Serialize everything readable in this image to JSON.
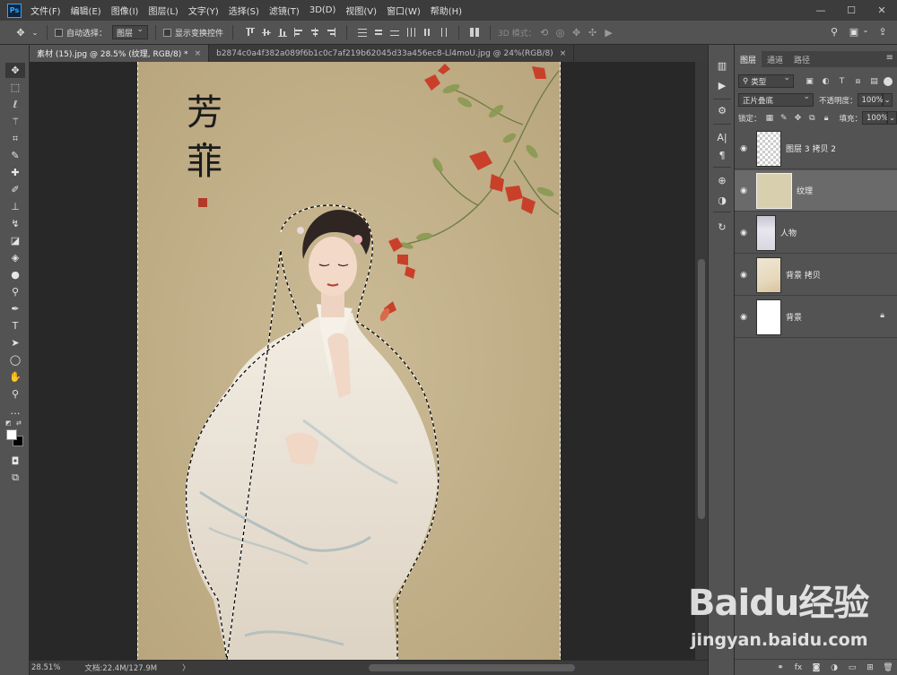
{
  "app": {
    "logo": "Ps"
  },
  "menu": [
    "文件(F)",
    "编辑(E)",
    "图像(I)",
    "图层(L)",
    "文字(Y)",
    "选择(S)",
    "滤镜(T)",
    "3D(D)",
    "视图(V)",
    "窗口(W)",
    "帮助(H)"
  ],
  "window_controls": {
    "minimize": "—",
    "maximize": "☐",
    "close": "✕"
  },
  "options": {
    "auto_select_label": "自动选择：",
    "auto_select_target": "图层",
    "show_transform_label": "显示变换控件",
    "mode_3d_label": "3D 模式："
  },
  "tabs": [
    {
      "title": "素材 (15).jpg @ 28.5% (纹理, RGB/8) *",
      "close": "×"
    },
    {
      "title": "b2874c0a4f382a089f6b1c0c7af219b62045d33a456ec8-Ll4moU.jpg @ 24%(RGB/8)",
      "close": "×"
    }
  ],
  "canvas": {
    "title_chars": [
      "芳",
      "菲"
    ],
    "background_color": "#c4b38d"
  },
  "status": {
    "zoom": "28.51%",
    "doc_info": "文档:22.4M/127.9M",
    "arrow": "〉"
  },
  "panel": {
    "tabs": [
      "图层",
      "通道",
      "路径"
    ],
    "menu_icon": "≡",
    "filter_kind": "类型",
    "blend_mode": "正片叠底",
    "opacity_label": "不透明度：",
    "opacity_value": "100%",
    "lock_label": "锁定：",
    "fill_label": "填充：",
    "fill_value": "100%"
  },
  "layers": [
    {
      "name": "图层 3 拷贝 2",
      "thumb": "transparent",
      "selected": false,
      "locked": false
    },
    {
      "name": "纹理",
      "thumb": "texture",
      "selected": true,
      "locked": false
    },
    {
      "name": "人物",
      "thumb": "person",
      "selected": false,
      "locked": false
    },
    {
      "name": "背景 拷贝",
      "thumb": "bgcopy",
      "selected": false,
      "locked": false
    },
    {
      "name": "背景",
      "thumb": "white",
      "selected": false,
      "locked": true
    }
  ],
  "watermark": {
    "logo": "Baidu经验",
    "url": "jingyan.baidu.com"
  },
  "colors": {
    "accent": "#31a8ff",
    "menubar": "#3c3c3c",
    "panel": "#535353",
    "canvas_bg": "#282828"
  }
}
